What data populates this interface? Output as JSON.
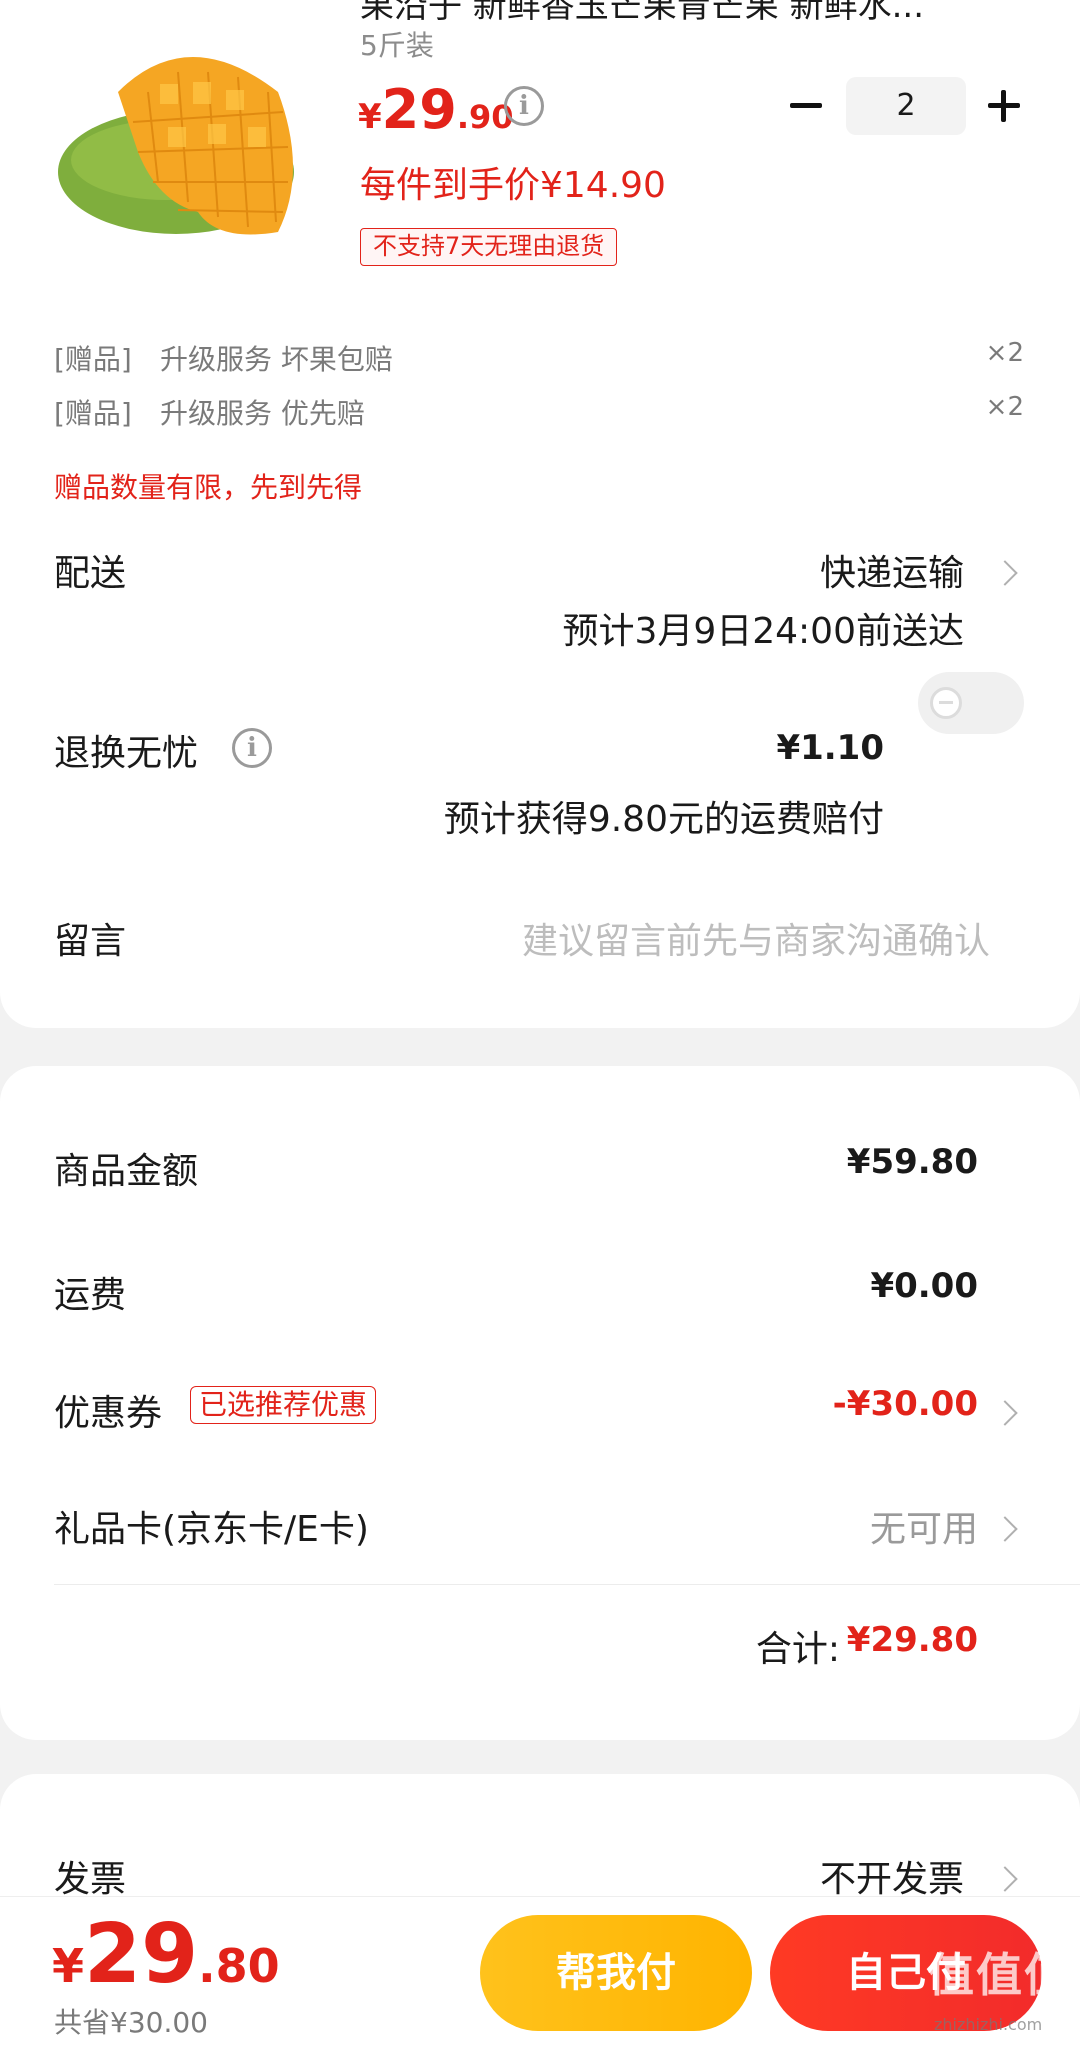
{
  "product": {
    "title": "果沿子 新鲜香玉芒果青芒果 新鲜水...",
    "spec": "5斤装",
    "price_currency": "¥",
    "price_int": "29",
    "price_dec": ".90",
    "unit_price": "每件到手价¥14.90",
    "no_return_tag": "不支持7天无理由退货",
    "quantity": "2",
    "image_icon": "mango-image"
  },
  "gifts": [
    {
      "tag": "[赠品]",
      "name": "升级服务 坏果包赔",
      "qty": "×2"
    },
    {
      "tag": "[赠品]",
      "name": "升级服务 优先赔",
      "qty": "×2"
    }
  ],
  "gift_note": "赠品数量有限，先到先得",
  "delivery": {
    "label": "配送",
    "method": "快递运输",
    "eta": "预计3月9日24:00前送达"
  },
  "return_service": {
    "label": "退换无忧",
    "price": "¥1.10",
    "note": "预计获得9.80元的运费赔付",
    "enabled": false
  },
  "message": {
    "label": "留言",
    "placeholder": "建议留言前先与商家沟通确认"
  },
  "summary": {
    "goods_label": "商品金额",
    "goods_value": "¥59.80",
    "shipping_label": "运费",
    "shipping_value": "¥0.00",
    "coupon_label": "优惠券",
    "coupon_tag": "已选推荐优惠",
    "coupon_value": "-¥30.00",
    "giftcard_label": "礼品卡(京东卡/E卡)",
    "giftcard_value": "无可用",
    "total_label": "合计:",
    "total_value": "¥29.80"
  },
  "invoice": {
    "label": "发票",
    "value": "不开发票"
  },
  "bottom": {
    "price_currency": "¥",
    "price_int": "29",
    "price_dec": ".80",
    "saved": "共省¥30.00",
    "help_pay": "帮我付",
    "self_pay": "自己付",
    "watermark": "值值值",
    "watermark_sub": "zhizhizhi.com"
  },
  "colors": {
    "accent_red": "#e2231a",
    "help_button": "#ffb400",
    "self_button": "#f22b2b"
  }
}
